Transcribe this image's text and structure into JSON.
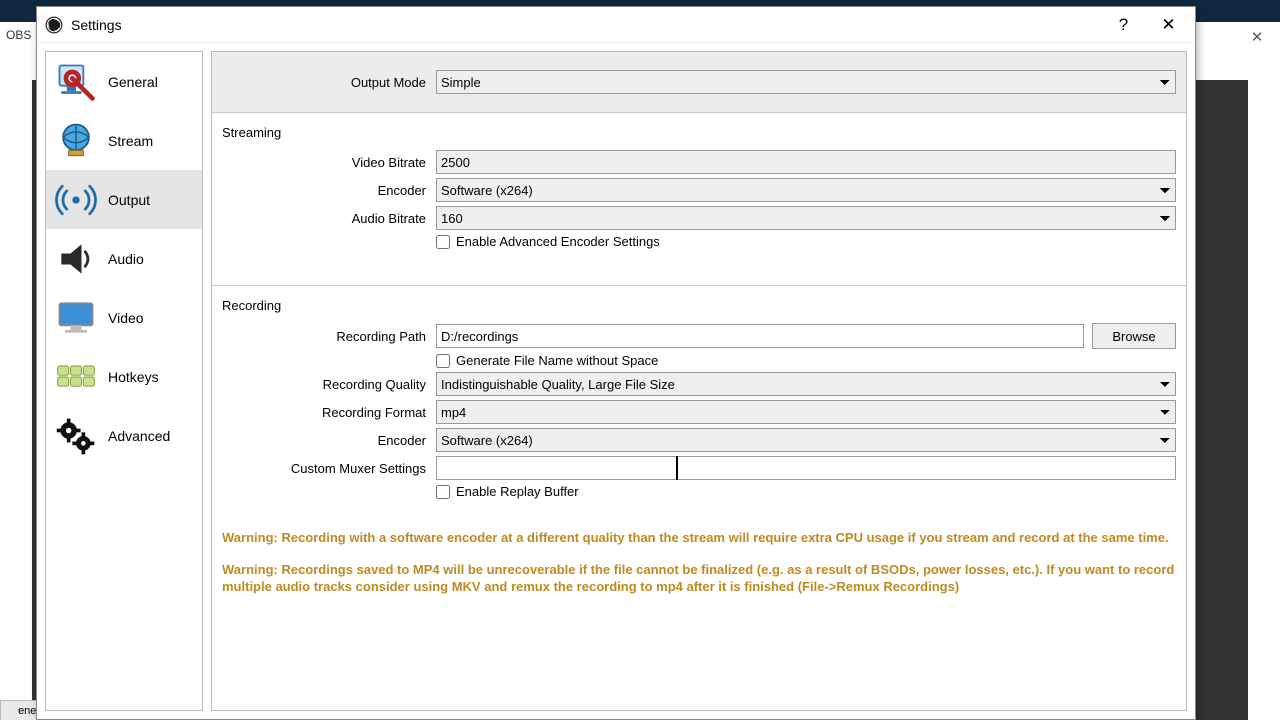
{
  "background": {
    "app_stub": "OBS",
    "close_glyph": "✕",
    "bottom_tab": "enes"
  },
  "window": {
    "title": "Settings",
    "help_glyph": "?",
    "close_glyph": "✕"
  },
  "sidebar": {
    "items": [
      {
        "label": "General"
      },
      {
        "label": "Stream"
      },
      {
        "label": "Output"
      },
      {
        "label": "Audio"
      },
      {
        "label": "Video"
      },
      {
        "label": "Hotkeys"
      },
      {
        "label": "Advanced"
      }
    ],
    "selected_index": 2
  },
  "output_mode": {
    "label": "Output Mode",
    "value": "Simple"
  },
  "streaming": {
    "title": "Streaming",
    "video_bitrate": {
      "label": "Video Bitrate",
      "value": "2500"
    },
    "encoder": {
      "label": "Encoder",
      "value": "Software (x264)"
    },
    "audio_bitrate": {
      "label": "Audio Bitrate",
      "value": "160"
    },
    "advanced_cb": {
      "label": "Enable Advanced Encoder Settings",
      "checked": false
    }
  },
  "recording": {
    "title": "Recording",
    "path": {
      "label": "Recording Path",
      "value": "D:/recordings",
      "browse": "Browse"
    },
    "no_space_cb": {
      "label": "Generate File Name without Space",
      "checked": false
    },
    "quality": {
      "label": "Recording Quality",
      "value": "Indistinguishable Quality, Large File Size"
    },
    "format": {
      "label": "Recording Format",
      "value": "mp4"
    },
    "encoder": {
      "label": "Encoder",
      "value": "Software (x264)"
    },
    "muxer": {
      "label": "Custom Muxer Settings",
      "value": ""
    },
    "replay_cb": {
      "label": "Enable Replay Buffer",
      "checked": false
    }
  },
  "warnings": {
    "w1": "Warning: Recording with a software encoder at a different quality than the stream will require extra CPU usage if you stream and record at the same time.",
    "w2": "Warning: Recordings saved to MP4 will be unrecoverable if the file cannot be finalized (e.g. as a result of BSODs, power losses, etc.). If you want to record multiple audio tracks consider using MKV and remux the recording to mp4 after it is finished (File->Remux Recordings)"
  }
}
